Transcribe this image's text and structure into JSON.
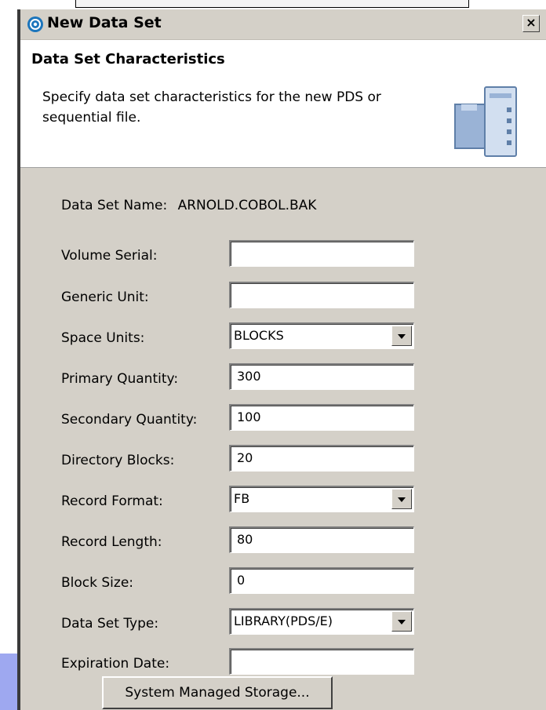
{
  "window": {
    "title": "New Data Set",
    "close_label": "×"
  },
  "header": {
    "title": "Data Set Characteristics",
    "description": "Specify data set characteristics for the new PDS or sequential file."
  },
  "data_set_name": {
    "label": "Data Set Name:",
    "value": "ARNOLD.COBOL.BAK"
  },
  "fields": {
    "volume_serial": {
      "label": "Volume Serial:",
      "value": ""
    },
    "generic_unit": {
      "label": "Generic Unit:",
      "value": ""
    },
    "space_units": {
      "label": "Space Units:",
      "value": "BLOCKS"
    },
    "primary_quantity": {
      "label": "Primary Quantity:",
      "value": "300"
    },
    "secondary_quantity": {
      "label": "Secondary Quantity:",
      "value": "100"
    },
    "directory_blocks": {
      "label": "Directory Blocks:",
      "value": "20"
    },
    "record_format": {
      "label": "Record Format:",
      "value": "FB"
    },
    "record_length": {
      "label": "Record Length:",
      "value": "80"
    },
    "block_size": {
      "label": "Block Size:",
      "value": "0"
    },
    "data_set_type": {
      "label": "Data Set Type:",
      "value": "LIBRARY(PDS/E)"
    },
    "expiration_date": {
      "label": "Expiration Date:",
      "value": ""
    }
  },
  "buttons": {
    "system_managed_storage": "System Managed Storage..."
  },
  "icons": {
    "app": "eclipse-icon",
    "header": "server-icon",
    "close": "close-icon",
    "dropdown": "chevron-down-icon"
  }
}
